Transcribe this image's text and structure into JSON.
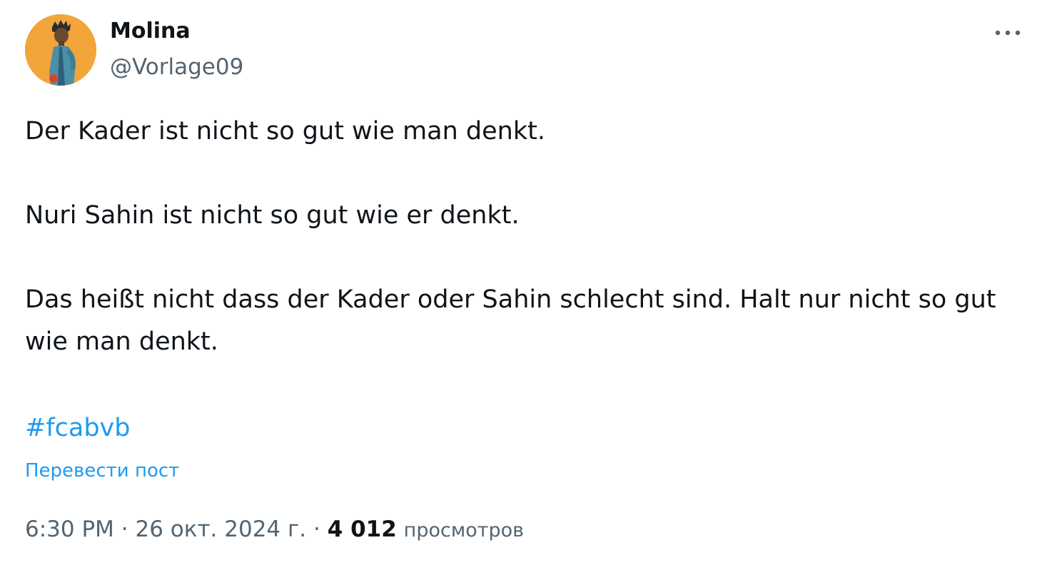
{
  "author": {
    "name": "Molina",
    "handle": "@Vorlage09"
  },
  "menu": {
    "more_icon": "more-horizontal-icon"
  },
  "tweet": {
    "paragraphs": [
      "Der Kader ist nicht so gut wie man denkt.",
      "Nuri Sahin ist nicht so gut wie er denkt.",
      "Das heißt nicht dass der Kader oder Sahin schlecht sind. Halt nur nicht so gut wie man denkt."
    ],
    "hashtag": "#fcabvb",
    "translate_label": "Перевести пост"
  },
  "meta": {
    "time": "6:30 PM",
    "separator": "·",
    "date": "26 окт. 2024 г.",
    "views_count": "4 012",
    "views_label": "просмотров"
  },
  "colors": {
    "link": "#1d9bf0",
    "text": "#0f1419",
    "secondary": "#536471",
    "avatar_bg": "#f2a53a"
  }
}
